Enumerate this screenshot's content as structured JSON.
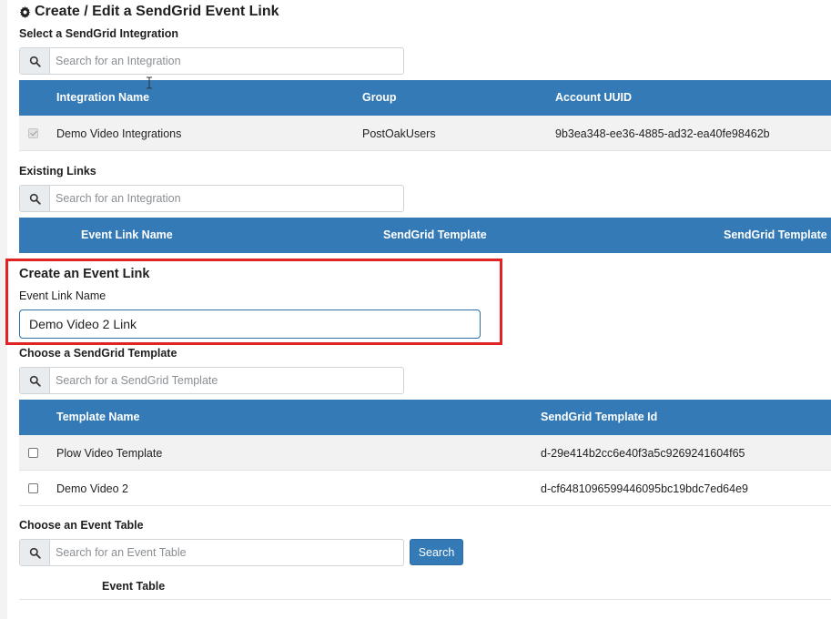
{
  "page": {
    "title": "Create / Edit a SendGrid Event Link",
    "title_icon": "gear-icon"
  },
  "integration_section": {
    "label": "Select a SendGrid Integration",
    "search_placeholder": "Search for an Integration",
    "columns": [
      "Integration Name",
      "Group",
      "Account UUID"
    ],
    "rows": [
      {
        "checked": true,
        "disabled": true,
        "name": "Demo Video Integrations",
        "group": "PostOakUsers",
        "uuid": "9b3ea348-ee36-4885-ad32-ea40fe98462b"
      }
    ]
  },
  "existing_links_section": {
    "label": "Existing Links",
    "search_placeholder": "Search for an Integration",
    "columns": [
      "Event Link Name",
      "SendGrid Template",
      "SendGrid Template I"
    ]
  },
  "create_section": {
    "heading": "Create an Event Link",
    "field_label": "Event Link Name",
    "field_value": "Demo Video 2 Link"
  },
  "template_section": {
    "label": "Choose a SendGrid Template",
    "search_placeholder": "Search for a SendGrid Template",
    "columns": [
      "Template Name",
      "SendGrid Template Id"
    ],
    "rows": [
      {
        "checked": false,
        "name": "Plow Video Template",
        "id": "d-29e414b2cc6e40f3a5c9269241604f65"
      },
      {
        "checked": false,
        "name": "Demo Video 2",
        "id": "d-cf6481096599446095bc19bdc7ed64e9"
      }
    ]
  },
  "event_table_section": {
    "label": "Choose an Event Table",
    "search_placeholder": "Search for an Event Table",
    "search_button": "Search",
    "columns": [
      "Event Table"
    ]
  },
  "colors": {
    "header_blue": "#337ab7",
    "highlight_red": "#e02424",
    "stripe": "#f2f2f2"
  }
}
